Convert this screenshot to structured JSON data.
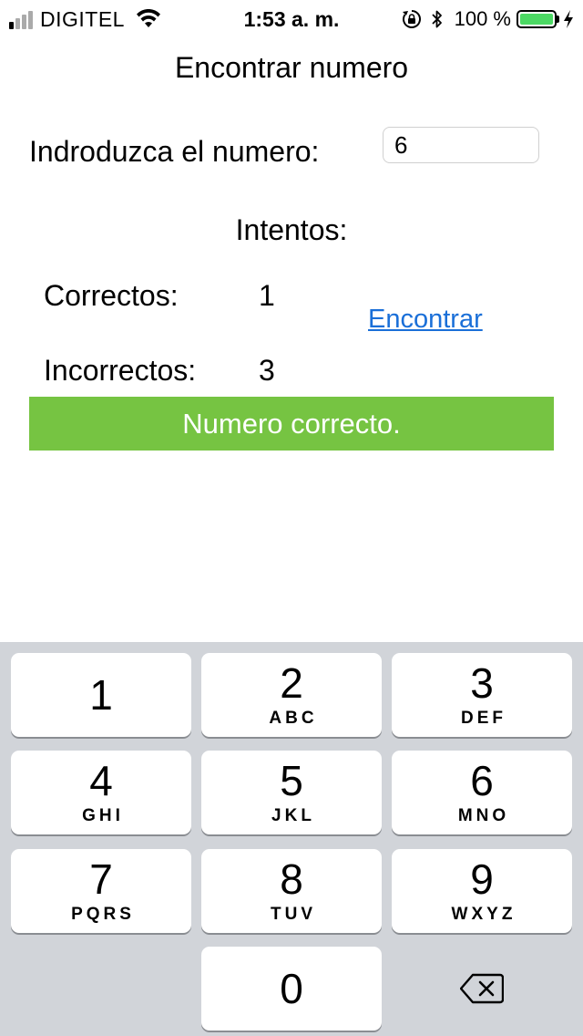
{
  "status_bar": {
    "carrier": "DIGITEL",
    "time": "1:53 a. m.",
    "battery_percent": "100 %",
    "battery_level": 1.0,
    "icons": [
      "signal-icon",
      "wifi-icon",
      "orientation-lock-icon",
      "bluetooth-icon",
      "battery-icon",
      "charging-bolt-icon"
    ],
    "colors": {
      "battery_fill": "#4cd964"
    }
  },
  "app": {
    "title": "Encontrar numero",
    "input_label": "Indroduzca el numero:",
    "input_value": "6",
    "attempts_heading": "Intentos:",
    "correct_label": "Correctos:",
    "correct_value": "1",
    "incorrect_label": "Incorrectos:",
    "incorrect_value": "3",
    "find_button": "Encontrar",
    "result_message": "Numero correcto.",
    "colors": {
      "link": "#1a6fd8",
      "result_background": "#76c442"
    }
  },
  "keypad": {
    "keys": [
      {
        "digit": "1",
        "letters": ""
      },
      {
        "digit": "2",
        "letters": "ABC"
      },
      {
        "digit": "3",
        "letters": "DEF"
      },
      {
        "digit": "4",
        "letters": "GHI"
      },
      {
        "digit": "5",
        "letters": "JKL"
      },
      {
        "digit": "6",
        "letters": "MNO"
      },
      {
        "digit": "7",
        "letters": "PQRS"
      },
      {
        "digit": "8",
        "letters": "TUV"
      },
      {
        "digit": "9",
        "letters": "WXYZ"
      },
      {
        "digit": "0",
        "letters": ""
      }
    ],
    "delete_icon": "backspace-icon"
  }
}
